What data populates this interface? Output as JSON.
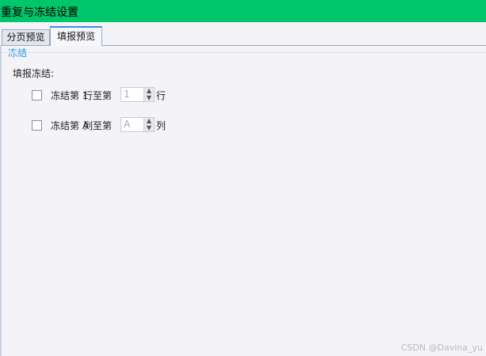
{
  "window": {
    "title": "重复与冻结设置",
    "accent_color": "#00c66b"
  },
  "tabs": [
    {
      "label": "分页预览",
      "active": false
    },
    {
      "label": "填报预览",
      "active": true
    }
  ],
  "section": {
    "title": "冻结",
    "group_label": "填报冻结:"
  },
  "rows": [
    {
      "checked": false,
      "prefix": "冻结第",
      "start": "1",
      "infix": "行至第",
      "value": "1",
      "suffix": "行"
    },
    {
      "checked": false,
      "prefix": "冻结第",
      "start": "A",
      "infix": "列至第",
      "value": "A",
      "suffix": "列"
    }
  ],
  "icons": {
    "spin_up": "chevron-up-icon",
    "spin_down": "chevron-down-icon"
  },
  "watermark": "CSDN @Davina_yu"
}
